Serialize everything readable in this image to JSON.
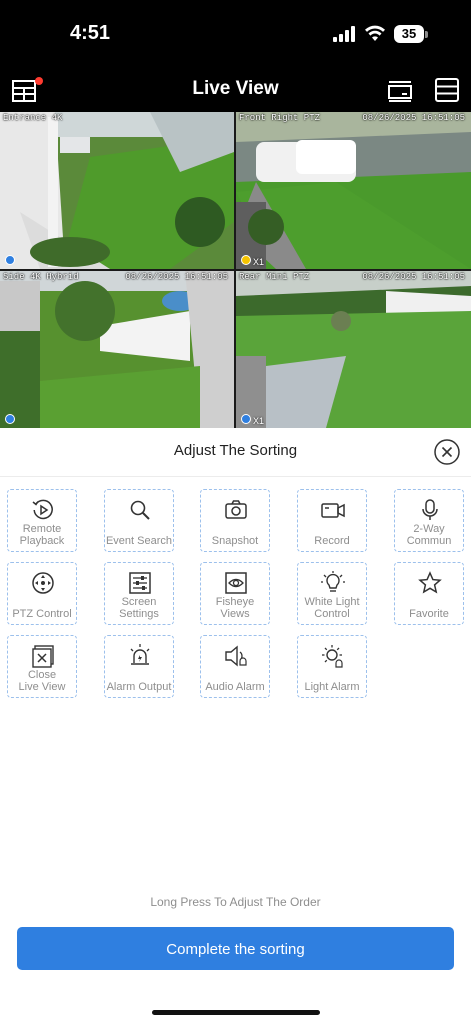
{
  "status_bar": {
    "time": "4:51",
    "battery": "35"
  },
  "nav": {
    "title": "Live View",
    "icons": [
      "layout-icon",
      "split-screen-icon",
      "menu-icon"
    ]
  },
  "cameras": [
    {
      "label": "Entrance 4K",
      "timestamp": "",
      "indicator": "blue",
      "zoom": ""
    },
    {
      "label": "Front Right PTZ",
      "timestamp": "08/26/2025 16:51:05",
      "indicator": "yellow",
      "zoom": "X1"
    },
    {
      "label": "Side 4K Hybrid",
      "timestamp": "08/26/2025 16:51:05",
      "indicator": "blue",
      "zoom": ""
    },
    {
      "label": "Rear Mini PTZ",
      "timestamp": "08/26/2025 16:51:05",
      "indicator": "blue",
      "zoom": "X1"
    }
  ],
  "sheet": {
    "title": "Adjust The Sorting",
    "tiles": [
      {
        "lines": [
          "Remote",
          "Playback"
        ],
        "icon": "playback-icon"
      },
      {
        "lines": [
          "Event Search"
        ],
        "icon": "search-icon"
      },
      {
        "lines": [
          "Snapshot"
        ],
        "icon": "camera-icon"
      },
      {
        "lines": [
          "Record"
        ],
        "icon": "video-record-icon"
      },
      {
        "lines": [
          "2-Way",
          "Commun"
        ],
        "icon": "microphone-icon"
      },
      {
        "lines": [
          "PTZ Control"
        ],
        "icon": "ptz-icon"
      },
      {
        "lines": [
          "Screen",
          "Settings"
        ],
        "icon": "sliders-icon"
      },
      {
        "lines": [
          "Fisheye",
          "Views"
        ],
        "icon": "fisheye-icon"
      },
      {
        "lines": [
          "White Light",
          "Control"
        ],
        "icon": "light-bulb-icon"
      },
      {
        "lines": [
          "Favorite"
        ],
        "icon": "star-icon"
      },
      {
        "lines": [
          "Close",
          "Live View"
        ],
        "icon": "close-view-icon"
      },
      {
        "lines": [
          "Alarm Output"
        ],
        "icon": "siren-icon"
      },
      {
        "lines": [
          "Audio Alarm"
        ],
        "icon": "speaker-alarm-icon"
      },
      {
        "lines": [
          "Light Alarm"
        ],
        "icon": "light-alarm-icon"
      }
    ],
    "hint": "Long Press To Adjust The Order",
    "complete_label": "Complete the sorting"
  },
  "colors": {
    "accent": "#2f7fe0",
    "tile_border": "#9cc0ec",
    "tile_text": "#8e8e8e",
    "indicator_blue": "#2f7fe0",
    "indicator_yellow": "#f5c400"
  }
}
